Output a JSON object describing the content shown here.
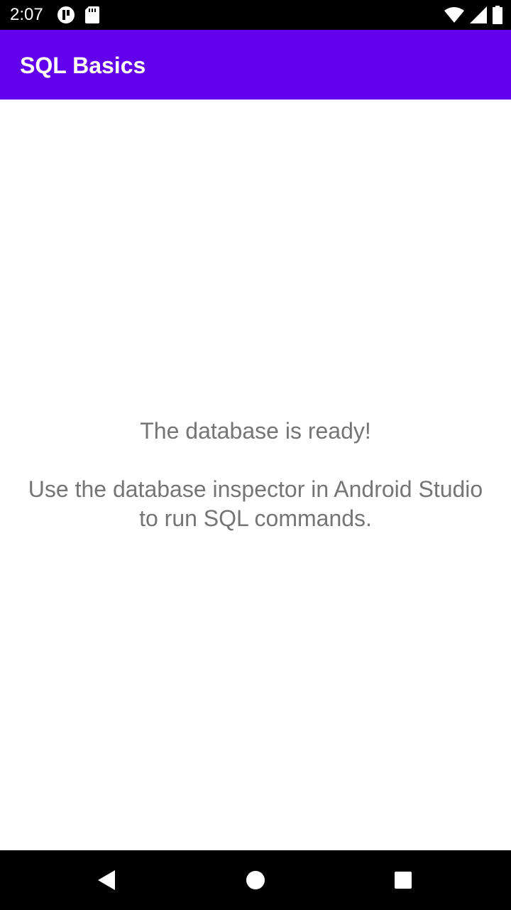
{
  "status_bar": {
    "time": "2:07",
    "icons_left": [
      "data-saver-icon",
      "sd-card-icon"
    ],
    "icons_right": [
      "wifi-icon",
      "cell-signal-icon",
      "battery-icon"
    ]
  },
  "app_bar": {
    "title": "SQL Basics",
    "color": "#6200ee"
  },
  "content": {
    "line1": "The database is ready!",
    "line2": "Use the database inspector in Android Studio",
    "line3": "to run SQL commands.",
    "text_color": "#757575"
  },
  "nav_bar": {
    "buttons": [
      "back-icon",
      "home-icon",
      "recents-icon"
    ]
  }
}
